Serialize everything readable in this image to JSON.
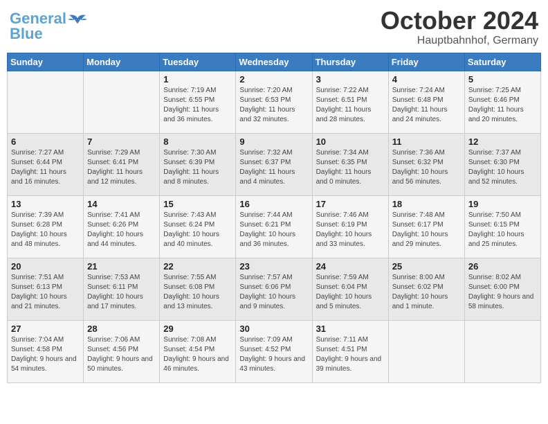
{
  "header": {
    "logo_line1": "General",
    "logo_line2": "Blue",
    "month": "October 2024",
    "location": "Hauptbahnhof, Germany"
  },
  "days_of_week": [
    "Sunday",
    "Monday",
    "Tuesday",
    "Wednesday",
    "Thursday",
    "Friday",
    "Saturday"
  ],
  "weeks": [
    [
      {
        "day": "",
        "info": ""
      },
      {
        "day": "",
        "info": ""
      },
      {
        "day": "1",
        "info": "Sunrise: 7:19 AM\nSunset: 6:55 PM\nDaylight: 11 hours and 36 minutes."
      },
      {
        "day": "2",
        "info": "Sunrise: 7:20 AM\nSunset: 6:53 PM\nDaylight: 11 hours and 32 minutes."
      },
      {
        "day": "3",
        "info": "Sunrise: 7:22 AM\nSunset: 6:51 PM\nDaylight: 11 hours and 28 minutes."
      },
      {
        "day": "4",
        "info": "Sunrise: 7:24 AM\nSunset: 6:48 PM\nDaylight: 11 hours and 24 minutes."
      },
      {
        "day": "5",
        "info": "Sunrise: 7:25 AM\nSunset: 6:46 PM\nDaylight: 11 hours and 20 minutes."
      }
    ],
    [
      {
        "day": "6",
        "info": "Sunrise: 7:27 AM\nSunset: 6:44 PM\nDaylight: 11 hours and 16 minutes."
      },
      {
        "day": "7",
        "info": "Sunrise: 7:29 AM\nSunset: 6:41 PM\nDaylight: 11 hours and 12 minutes."
      },
      {
        "day": "8",
        "info": "Sunrise: 7:30 AM\nSunset: 6:39 PM\nDaylight: 11 hours and 8 minutes."
      },
      {
        "day": "9",
        "info": "Sunrise: 7:32 AM\nSunset: 6:37 PM\nDaylight: 11 hours and 4 minutes."
      },
      {
        "day": "10",
        "info": "Sunrise: 7:34 AM\nSunset: 6:35 PM\nDaylight: 11 hours and 0 minutes."
      },
      {
        "day": "11",
        "info": "Sunrise: 7:36 AM\nSunset: 6:32 PM\nDaylight: 10 hours and 56 minutes."
      },
      {
        "day": "12",
        "info": "Sunrise: 7:37 AM\nSunset: 6:30 PM\nDaylight: 10 hours and 52 minutes."
      }
    ],
    [
      {
        "day": "13",
        "info": "Sunrise: 7:39 AM\nSunset: 6:28 PM\nDaylight: 10 hours and 48 minutes."
      },
      {
        "day": "14",
        "info": "Sunrise: 7:41 AM\nSunset: 6:26 PM\nDaylight: 10 hours and 44 minutes."
      },
      {
        "day": "15",
        "info": "Sunrise: 7:43 AM\nSunset: 6:24 PM\nDaylight: 10 hours and 40 minutes."
      },
      {
        "day": "16",
        "info": "Sunrise: 7:44 AM\nSunset: 6:21 PM\nDaylight: 10 hours and 36 minutes."
      },
      {
        "day": "17",
        "info": "Sunrise: 7:46 AM\nSunset: 6:19 PM\nDaylight: 10 hours and 33 minutes."
      },
      {
        "day": "18",
        "info": "Sunrise: 7:48 AM\nSunset: 6:17 PM\nDaylight: 10 hours and 29 minutes."
      },
      {
        "day": "19",
        "info": "Sunrise: 7:50 AM\nSunset: 6:15 PM\nDaylight: 10 hours and 25 minutes."
      }
    ],
    [
      {
        "day": "20",
        "info": "Sunrise: 7:51 AM\nSunset: 6:13 PM\nDaylight: 10 hours and 21 minutes."
      },
      {
        "day": "21",
        "info": "Sunrise: 7:53 AM\nSunset: 6:11 PM\nDaylight: 10 hours and 17 minutes."
      },
      {
        "day": "22",
        "info": "Sunrise: 7:55 AM\nSunset: 6:08 PM\nDaylight: 10 hours and 13 minutes."
      },
      {
        "day": "23",
        "info": "Sunrise: 7:57 AM\nSunset: 6:06 PM\nDaylight: 10 hours and 9 minutes."
      },
      {
        "day": "24",
        "info": "Sunrise: 7:59 AM\nSunset: 6:04 PM\nDaylight: 10 hours and 5 minutes."
      },
      {
        "day": "25",
        "info": "Sunrise: 8:00 AM\nSunset: 6:02 PM\nDaylight: 10 hours and 1 minute."
      },
      {
        "day": "26",
        "info": "Sunrise: 8:02 AM\nSunset: 6:00 PM\nDaylight: 9 hours and 58 minutes."
      }
    ],
    [
      {
        "day": "27",
        "info": "Sunrise: 7:04 AM\nSunset: 4:58 PM\nDaylight: 9 hours and 54 minutes."
      },
      {
        "day": "28",
        "info": "Sunrise: 7:06 AM\nSunset: 4:56 PM\nDaylight: 9 hours and 50 minutes."
      },
      {
        "day": "29",
        "info": "Sunrise: 7:08 AM\nSunset: 4:54 PM\nDaylight: 9 hours and 46 minutes."
      },
      {
        "day": "30",
        "info": "Sunrise: 7:09 AM\nSunset: 4:52 PM\nDaylight: 9 hours and 43 minutes."
      },
      {
        "day": "31",
        "info": "Sunrise: 7:11 AM\nSunset: 4:51 PM\nDaylight: 9 hours and 39 minutes."
      },
      {
        "day": "",
        "info": ""
      },
      {
        "day": "",
        "info": ""
      }
    ]
  ]
}
